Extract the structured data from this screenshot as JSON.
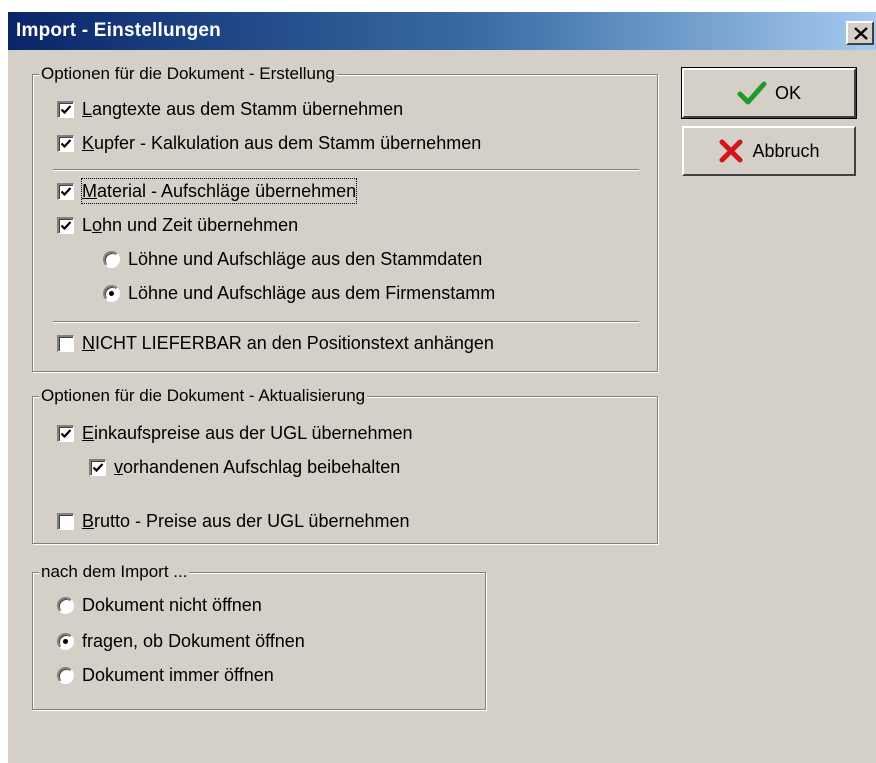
{
  "window": {
    "title": "Import - Einstellungen",
    "title_bar_color": "#0a246a",
    "face_color": "#d4d0c8"
  },
  "buttons": {
    "ok_label": "OK",
    "ok_icon": "green-checkmark-icon",
    "cancel_label": "Abbruch",
    "cancel_icon": "red-x-icon"
  },
  "group_create": {
    "title": "Optionen für die Dokument - Erstellung",
    "langtexte": {
      "accel": "L",
      "rest": "angtexte aus dem Stamm übernehmen",
      "checked": true
    },
    "kupfer": {
      "accel": "K",
      "rest": "upfer - Kalkulation aus dem Stamm übernehmen",
      "checked": true
    },
    "material": {
      "accel": "M",
      "rest": "aterial - Aufschläge übernehmen",
      "checked": true
    },
    "lohn": {
      "pre": "L",
      "accel": "o",
      "rest": "hn und Zeit übernehmen",
      "checked": true
    },
    "radio_stammdaten": {
      "label": "Löhne und Aufschläge aus den Stammdaten",
      "selected": false
    },
    "radio_firmenstamm": {
      "label": "Löhne und Aufschläge aus dem Firmenstamm",
      "selected": true
    },
    "nicht_lieferbar": {
      "accel": "N",
      "rest": "ICHT LIEFERBAR an den Positionstext anhängen",
      "checked": false
    }
  },
  "group_update": {
    "title": "Optionen für die Dokument - Aktualisierung",
    "einkaufspreise": {
      "accel": "E",
      "rest": "inkaufspreise aus der UGL übernehmen",
      "checked": true
    },
    "aufschlag": {
      "accel": "v",
      "rest": "orhandenen Aufschlag beibehalten",
      "checked": true
    },
    "brutto": {
      "accel": "B",
      "rest": "rutto - Preise aus der UGL übernehmen",
      "checked": false
    }
  },
  "group_after": {
    "title": "nach dem Import ...",
    "options": [
      {
        "label": "Dokument nicht öffnen",
        "selected": false
      },
      {
        "label": "fragen, ob Dokument öffnen",
        "selected": true
      },
      {
        "label": "Dokument immer öffnen",
        "selected": false
      }
    ]
  }
}
